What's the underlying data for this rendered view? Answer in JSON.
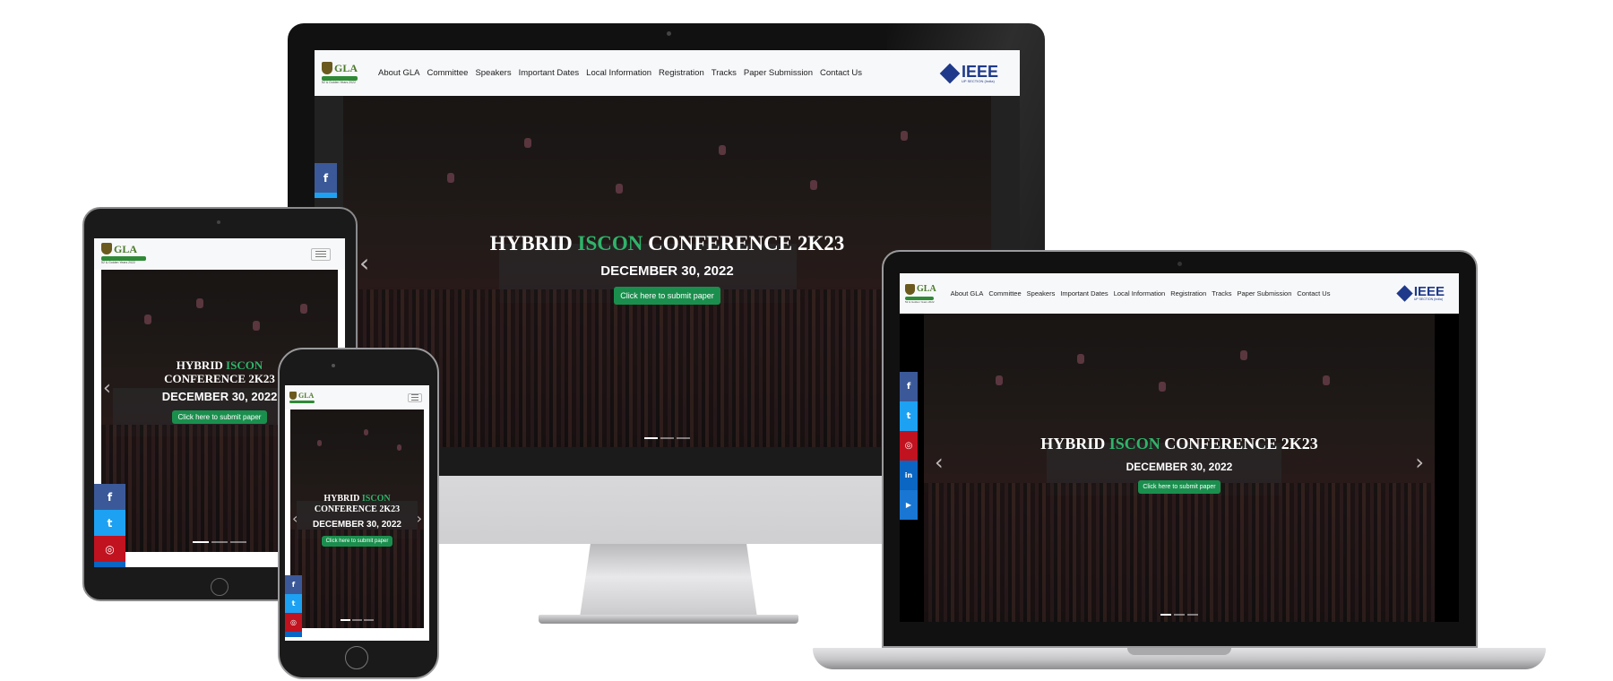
{
  "site": {
    "logo_text": "GLA",
    "logo_band_text": "UNIVERSITY",
    "logo_tagline": "52 & Golden Years 2022",
    "nav_items": [
      "About GLA",
      "Committee",
      "Speakers",
      "Important Dates",
      "Local Information",
      "Registration",
      "Tracks",
      "Paper Submission",
      "Contact Us"
    ],
    "partner_logo_text": "IEEE",
    "partner_logo_sub": "UP SECTION (India)",
    "hero_title_pre": "HYBRID ",
    "hero_title_accent": "ISCON",
    "hero_title_post": " CONFERENCE 2K23",
    "hero_title_line1_pre": "HYBRID ",
    "hero_title_line2": "CONFERENCE 2K23",
    "hero_date": "DECEMBER 30, 2022",
    "cta_label": "Click here to submit paper",
    "prev_arrow": "‹",
    "next_arrow": "›",
    "slides_count": 3,
    "active_slide": 1,
    "social_icons": [
      "facebook-icon",
      "twitter-icon",
      "instagram-icon",
      "linkedin-icon",
      "youtube-icon"
    ]
  },
  "devices": [
    "desktop-monitor",
    "laptop",
    "tablet",
    "phone"
  ],
  "colors": {
    "accent": "#2fb46a",
    "cta": "#1a8f4d",
    "facebook": "#3b5998",
    "twitter": "#1da1f2",
    "instagram": "#c1121f",
    "linkedin": "#0a66c2",
    "ieee_blue": "#1f3a8a"
  },
  "glyphs": {
    "apple": "",
    "facebook": "f",
    "twitter": "t",
    "instagram": "◎",
    "linkedin": "in",
    "youtube": "▶"
  }
}
